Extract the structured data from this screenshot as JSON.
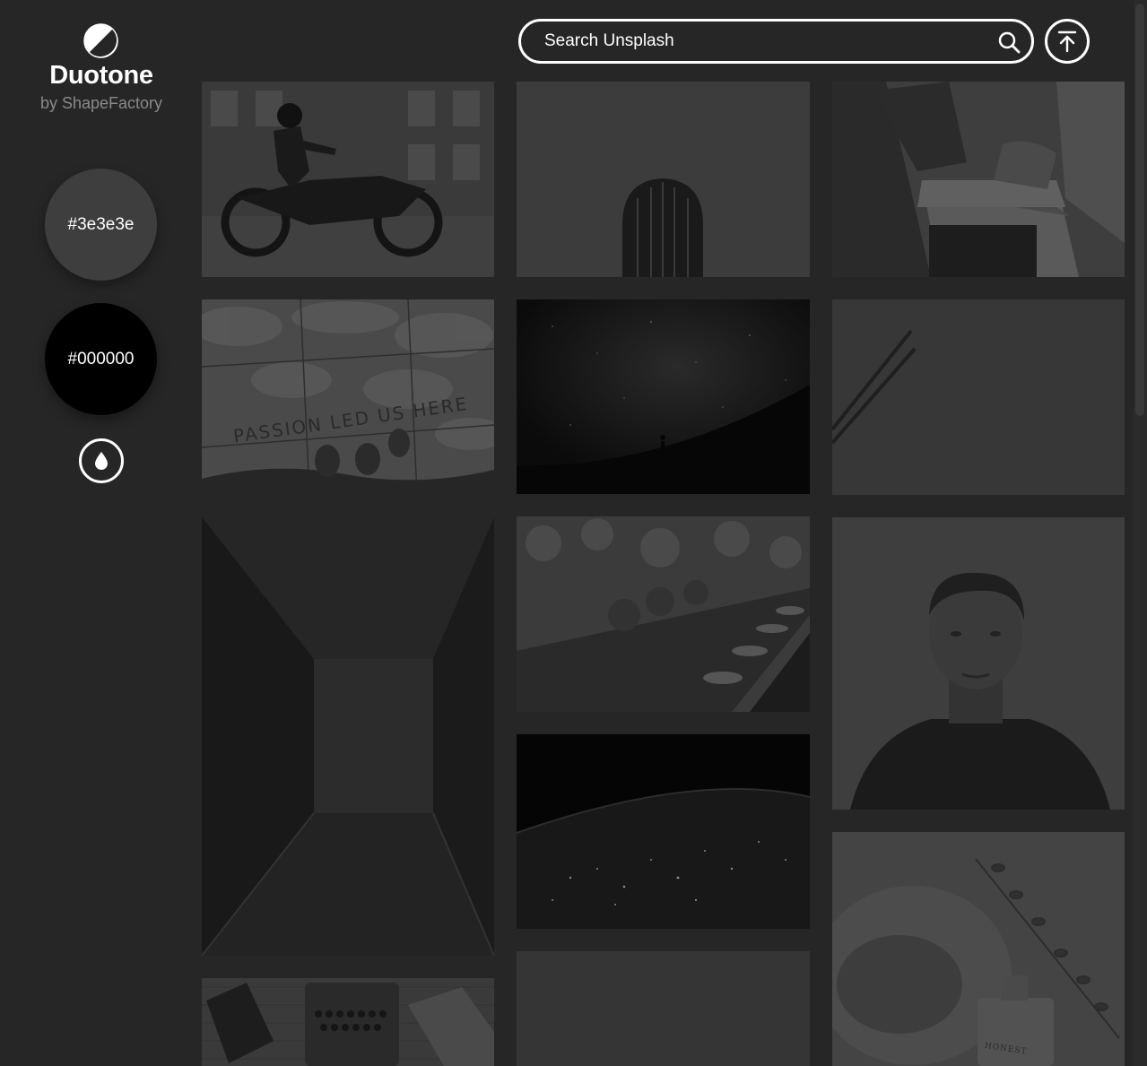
{
  "brand": {
    "title": "Duotone",
    "subtitle": "by ShapeFactory",
    "logo_icon": "half-circle-contrast-icon"
  },
  "palette": {
    "color_1": {
      "label": "#3e3e3e",
      "value": "#3e3e3e"
    },
    "color_2": {
      "label": "#000000",
      "value": "#000000"
    },
    "drop_icon": "water-drop-icon"
  },
  "search": {
    "placeholder": "Search Unsplash",
    "icon": "search-icon"
  },
  "top_button": {
    "icon": "arrow-up-to-top-icon"
  },
  "photos": [
    {
      "subject": "motorcycle-rider"
    },
    {
      "subject": "cactus"
    },
    {
      "subject": "laptop-desk"
    },
    {
      "subject": "passion-led-us-here"
    },
    {
      "subject": "night-sky-silhouette"
    },
    {
      "subject": "pencils"
    },
    {
      "subject": "corridor"
    },
    {
      "subject": "dinner-table"
    },
    {
      "subject": "earth-at-night"
    },
    {
      "subject": "portrait-man"
    },
    {
      "subject": "typewriter-desk"
    },
    {
      "subject": "plain-gray"
    },
    {
      "subject": "skincare-bottle"
    }
  ],
  "photo_text": {
    "passion": "PASSION LED US HERE",
    "honest": "HONEST"
  }
}
